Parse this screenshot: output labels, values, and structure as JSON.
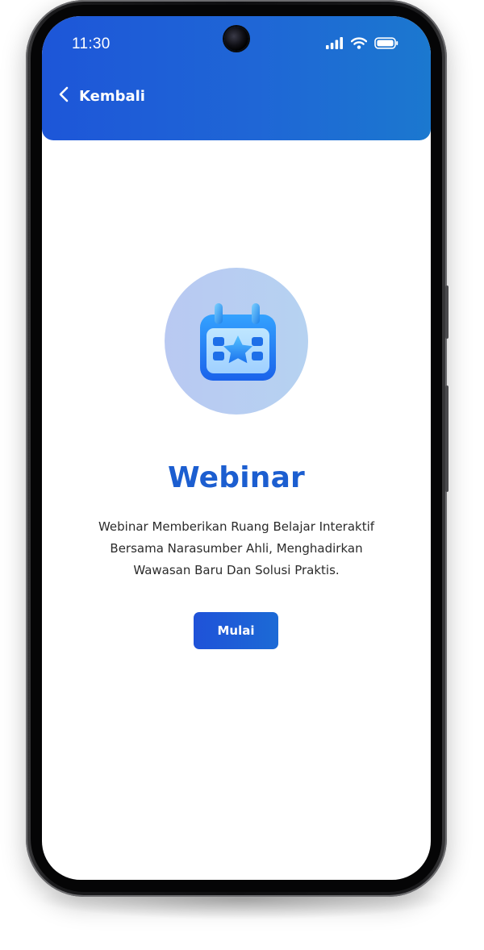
{
  "status_bar": {
    "time": "11:30",
    "icons": [
      "signal-icon",
      "wifi-icon",
      "battery-icon"
    ]
  },
  "header": {
    "back_label": "Kembali",
    "back_icon": "chevron-left-icon",
    "gradient_start": "#1d56d8",
    "gradient_end": "#1b78cf"
  },
  "feature": {
    "icon": "calendar-star-icon",
    "title": "Webinar",
    "description_lines": [
      "Webinar Memberikan Ruang Belajar Interaktif",
      "Bersama Narasumber Ahli, Menghadirkan",
      "Wawasan Baru Dan Solusi Praktis."
    ],
    "title_color": "#1c5ed0"
  },
  "actions": {
    "start_label": "Mulai"
  }
}
